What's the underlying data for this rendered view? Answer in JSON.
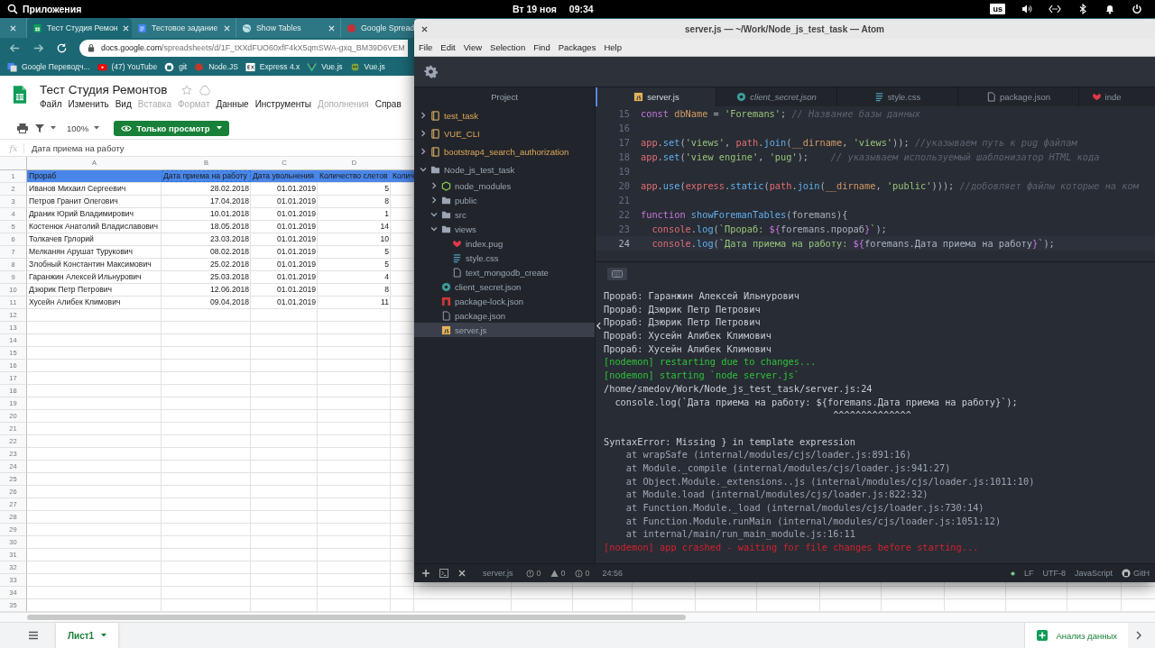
{
  "top_bar": {
    "apps_label": "Приложения",
    "date": "Вт 19 ноя",
    "time": "09:34",
    "keyboard_layout": "us"
  },
  "browser": {
    "tabs": [
      {
        "selected": false
      },
      {
        "label": "Тест Студия Ремон",
        "selected": true,
        "kind": "sheets"
      },
      {
        "label": "Тестовое задание",
        "selected": false,
        "kind": "docs"
      },
      {
        "label": "Show Tables",
        "selected": false,
        "kind": "globe"
      },
      {
        "label": "Google Spread",
        "selected": false,
        "kind": "red"
      }
    ],
    "address": {
      "host": "docs.google.com",
      "path": "/spreadsheets/d/1F_tXXdFUO60xfF4kX5qmSWA-gxq_BM39D6VEM"
    },
    "bookmarks": [
      {
        "label": "Google Переводч...",
        "kind": "translate"
      },
      {
        "label": "(47) YouTube",
        "kind": "youtube"
      },
      {
        "label": "git",
        "kind": "github"
      },
      {
        "label": "Node.JS",
        "kind": "node"
      },
      {
        "label": "Express 4.x",
        "kind": "express"
      },
      {
        "label": "Vue.js",
        "kind": "vue"
      },
      {
        "label": "Vue.js",
        "kind": "robot"
      }
    ]
  },
  "sheet": {
    "title": "Тест Студия Ремонтов",
    "menu": [
      {
        "label": "Файл",
        "disabled": false
      },
      {
        "label": "Изменить",
        "disabled": false
      },
      {
        "label": "Вид",
        "disabled": false
      },
      {
        "label": "Вставка",
        "disabled": true
      },
      {
        "label": "Формат",
        "disabled": true
      },
      {
        "label": "Данные",
        "disabled": false
      },
      {
        "label": "Инструменты",
        "disabled": false
      },
      {
        "label": "Дополнения",
        "disabled": true
      },
      {
        "label": "Справ",
        "disabled": false
      }
    ],
    "zoom": "100%",
    "mode_button": "Только просмотр",
    "fx_label": "fx",
    "formula": "Дата приема на работу",
    "column_headers": [
      "A",
      "B",
      "C",
      "D"
    ],
    "rows": [
      {
        "number": "1",
        "kind": "header",
        "cells": [
          {
            "text": "Прораб",
            "copied": false
          },
          {
            "text": "Дата приема на работу",
            "copied": true
          },
          {
            "text": "Дата увольнения",
            "copied": false
          },
          {
            "text": "Количество слетов",
            "copied": false
          },
          {
            "text": "Колич",
            "copied": false
          }
        ]
      },
      {
        "number": "2",
        "kind": "data",
        "cells": [
          {
            "text": "Иванов Михаил Сергеевич"
          },
          {
            "text": "28.02.2018"
          },
          {
            "text": "01.01.2019"
          },
          {
            "text": "5"
          }
        ]
      },
      {
        "number": "3",
        "kind": "data",
        "cells": [
          {
            "text": "Петров Гранит Олегович"
          },
          {
            "text": "17.04.2018"
          },
          {
            "text": "01.01.2019"
          },
          {
            "text": "8"
          }
        ]
      },
      {
        "number": "4",
        "kind": "data",
        "cells": [
          {
            "text": "Драник Юрий Владимирович"
          },
          {
            "text": "10.01.2018"
          },
          {
            "text": "01.01.2019"
          },
          {
            "text": "1"
          }
        ]
      },
      {
        "number": "5",
        "kind": "data",
        "cells": [
          {
            "text": "Костенюк Анатолий Владиславович"
          },
          {
            "text": "18.05.2018"
          },
          {
            "text": "01.01.2019"
          },
          {
            "text": "14"
          }
        ]
      },
      {
        "number": "6",
        "kind": "data",
        "cells": [
          {
            "text": "Толкачев Грлорий"
          },
          {
            "text": "23.03.2018"
          },
          {
            "text": "01.01.2019"
          },
          {
            "text": "10"
          }
        ]
      },
      {
        "number": "7",
        "kind": "data",
        "cells": [
          {
            "text": "Мелканян Арушат Турукович"
          },
          {
            "text": "08.02.2018"
          },
          {
            "text": "01.01.2019"
          },
          {
            "text": "5"
          }
        ]
      },
      {
        "number": "8",
        "kind": "data",
        "cells": [
          {
            "text": "Злобный Константин Максимович"
          },
          {
            "text": "25.02.2018"
          },
          {
            "text": "01.01.2019"
          },
          {
            "text": "5"
          }
        ]
      },
      {
        "number": "9",
        "kind": "data",
        "cells": [
          {
            "text": "Гаранжин Алексей Ильнурович"
          },
          {
            "text": "25.03.2018"
          },
          {
            "text": "01.01.2019"
          },
          {
            "text": "4"
          }
        ]
      },
      {
        "number": "10",
        "kind": "data",
        "cells": [
          {
            "text": "Дзюрик Петр Петрович"
          },
          {
            "text": "12.06.2018"
          },
          {
            "text": "01.01.2019"
          },
          {
            "text": "8"
          }
        ]
      },
      {
        "number": "11",
        "kind": "data",
        "cells": [
          {
            "text": "Хусейн Алибек Климович"
          },
          {
            "text": "09.04.2018"
          },
          {
            "text": "01.01.2019"
          },
          {
            "text": "11"
          }
        ]
      },
      {
        "number": "12"
      },
      {
        "number": "13"
      },
      {
        "number": "14"
      },
      {
        "number": "15"
      },
      {
        "number": "16"
      },
      {
        "number": "17"
      },
      {
        "number": "18"
      },
      {
        "number": "19"
      },
      {
        "number": "20"
      },
      {
        "number": "21"
      },
      {
        "number": "22"
      },
      {
        "number": "23"
      },
      {
        "number": "24"
      },
      {
        "number": "25"
      },
      {
        "number": "26"
      },
      {
        "number": "27"
      },
      {
        "number": "28"
      },
      {
        "number": "29"
      },
      {
        "number": "30"
      },
      {
        "number": "31"
      },
      {
        "number": "32"
      },
      {
        "number": "33"
      },
      {
        "number": "34"
      },
      {
        "number": "35"
      }
    ],
    "sheet_tabs": [
      {
        "label": "Лист1",
        "selected": true
      }
    ],
    "explore_button": "Анализ данных"
  },
  "atom": {
    "title": "server.js — ~/Work/Node_js_test_task — Atom",
    "menu": [
      "File",
      "Edit",
      "View",
      "Selection",
      "Find",
      "Packages",
      "Help"
    ],
    "tree_title": "Project",
    "tree": [
      {
        "label": "test_task",
        "kind": "repo",
        "expanded": false,
        "selected": false
      },
      {
        "label": "VUE_CLI",
        "kind": "repo",
        "expanded": false,
        "selected": false
      },
      {
        "label": "bootstrap4_search_authorization",
        "kind": "repo",
        "expanded": false,
        "selected": false
      },
      {
        "label": "Node_js_test_task",
        "kind": "folder",
        "expanded": true,
        "selected": false,
        "children": [
          {
            "label": "node_modules",
            "kind": "node",
            "expanded": false,
            "selected": false
          },
          {
            "label": "public",
            "kind": "folder",
            "expanded": false,
            "selected": false
          },
          {
            "label": "src",
            "kind": "folder",
            "expanded": true,
            "selected": false
          },
          {
            "label": "views",
            "kind": "folder",
            "expanded": true,
            "selected": false,
            "children": [
              {
                "label": "index.pug",
                "kind": "pug",
                "selected": false
              },
              {
                "label": "style.css",
                "kind": "css",
                "selected": false
              },
              {
                "label": "text_mongodb_create",
                "kind": "file",
                "selected": false
              }
            ]
          },
          {
            "label": "client_secret.json",
            "kind": "secret",
            "selected": false
          },
          {
            "label": "package-lock.json",
            "kind": "npm",
            "selected": false
          },
          {
            "label": "package.json",
            "kind": "file",
            "selected": false
          },
          {
            "label": "server.js",
            "kind": "js",
            "selected": true
          }
        ]
      }
    ],
    "tabs": [
      {
        "label": "server.js",
        "kind": "js",
        "selected": true,
        "pending": false
      },
      {
        "label": "client_secret.json",
        "kind": "secret",
        "selected": false,
        "pending": true
      },
      {
        "label": "style.css",
        "kind": "css",
        "selected": false,
        "pending": false
      },
      {
        "label": "package.json",
        "kind": "file",
        "selected": false,
        "pending": false
      },
      {
        "label": "inde",
        "kind": "pug",
        "selected": false,
        "pending": false
      }
    ],
    "code": [
      {
        "number": "15",
        "current": false,
        "tokens": [
          {
            "kind": "kw",
            "text": "const "
          },
          {
            "kind": "var",
            "text": "dbName"
          },
          {
            "kind": "p",
            "text": " = "
          },
          {
            "kind": "str",
            "text": "'Foremans'"
          },
          {
            "kind": "p",
            "text": "; "
          },
          {
            "kind": "com",
            "text": "// Название базы данных"
          }
        ]
      },
      {
        "number": "16",
        "current": false
      },
      {
        "number": "17",
        "current": false,
        "tokens": [
          {
            "kind": "obj",
            "text": "app"
          },
          {
            "kind": "p",
            "text": "."
          },
          {
            "kind": "fn",
            "text": "set"
          },
          {
            "kind": "p",
            "text": "("
          },
          {
            "kind": "str",
            "text": "'views'"
          },
          {
            "kind": "p",
            "text": ", "
          },
          {
            "kind": "obj",
            "text": "path"
          },
          {
            "kind": "p",
            "text": "."
          },
          {
            "kind": "fn",
            "text": "join"
          },
          {
            "kind": "p",
            "text": "("
          },
          {
            "kind": "var",
            "text": "__dirname"
          },
          {
            "kind": "p",
            "text": ", "
          },
          {
            "kind": "str",
            "text": "'views'"
          },
          {
            "kind": "p",
            "text": ")); "
          },
          {
            "kind": "com",
            "text": "//указываем путь к pug файлам"
          }
        ]
      },
      {
        "number": "18",
        "current": false,
        "tokens": [
          {
            "kind": "obj",
            "text": "app"
          },
          {
            "kind": "p",
            "text": "."
          },
          {
            "kind": "fn",
            "text": "set"
          },
          {
            "kind": "p",
            "text": "("
          },
          {
            "kind": "str",
            "text": "'view engine'"
          },
          {
            "kind": "p",
            "text": ", "
          },
          {
            "kind": "str",
            "text": "'pug'"
          },
          {
            "kind": "p",
            "text": ");    "
          },
          {
            "kind": "com",
            "text": "// указываем используемый шаблонизатор HTML кода"
          }
        ]
      },
      {
        "number": "19",
        "current": false
      },
      {
        "number": "20",
        "current": false,
        "tokens": [
          {
            "kind": "obj",
            "text": "app"
          },
          {
            "kind": "p",
            "text": "."
          },
          {
            "kind": "fn",
            "text": "use"
          },
          {
            "kind": "p",
            "text": "("
          },
          {
            "kind": "obj",
            "text": "express"
          },
          {
            "kind": "p",
            "text": "."
          },
          {
            "kind": "fn",
            "text": "static"
          },
          {
            "kind": "p",
            "text": "("
          },
          {
            "kind": "obj",
            "text": "path"
          },
          {
            "kind": "p",
            "text": "."
          },
          {
            "kind": "fn",
            "text": "join"
          },
          {
            "kind": "p",
            "text": "("
          },
          {
            "kind": "var",
            "text": "__dirname"
          },
          {
            "kind": "p",
            "text": ", "
          },
          {
            "kind": "str",
            "text": "'public'"
          },
          {
            "kind": "p",
            "text": "))); "
          },
          {
            "kind": "com",
            "text": "//добовляет файлы которые на ком"
          }
        ]
      },
      {
        "number": "21",
        "current": false
      },
      {
        "number": "22",
        "current": false,
        "tokens": [
          {
            "kind": "kw",
            "text": "function "
          },
          {
            "kind": "fn",
            "text": "showForemanTables"
          },
          {
            "kind": "p",
            "text": "(foremans){"
          }
        ]
      },
      {
        "number": "23",
        "current": false,
        "tokens": [
          {
            "kind": "obj",
            "text": "  console"
          },
          {
            "kind": "p",
            "text": "."
          },
          {
            "kind": "fn",
            "text": "log"
          },
          {
            "kind": "p",
            "text": "("
          },
          {
            "kind": "str",
            "text": "`Прораб: "
          },
          {
            "kind": "tpl",
            "text": "${"
          },
          {
            "kind": "p",
            "text": "foremans.прораб"
          },
          {
            "kind": "tpl",
            "text": "}"
          },
          {
            "kind": "str",
            "text": "`"
          },
          {
            "kind": "p",
            "text": ");"
          }
        ]
      },
      {
        "number": "24",
        "current": true,
        "tokens": [
          {
            "kind": "obj",
            "text": "  console"
          },
          {
            "kind": "p",
            "text": "."
          },
          {
            "kind": "fn",
            "text": "log"
          },
          {
            "kind": "p",
            "text": "("
          },
          {
            "kind": "str",
            "text": "`Дата приема на работу: "
          },
          {
            "kind": "tpl",
            "text": "${"
          },
          {
            "kind": "p",
            "text": "foremans.Дата приема на работу"
          },
          {
            "kind": "tpl",
            "text": "}"
          },
          {
            "kind": "str",
            "text": "`"
          },
          {
            "kind": "p",
            "text": ");"
          }
        ]
      }
    ],
    "terminal": [
      {
        "kind": "out",
        "text": "Прораб: Гаранжин Алексей Ильнурович"
      },
      {
        "kind": "out",
        "text": "Прораб: Дзюрик Петр Петрович"
      },
      {
        "kind": "out",
        "text": "Прораб: Дзюрик Петр Петрович"
      },
      {
        "kind": "out",
        "text": "Прораб: Хусейн Алибек Климович"
      },
      {
        "kind": "out",
        "text": "Прораб: Хусейн Алибек Климович"
      },
      {
        "kind": "info",
        "text": "[nodemon] restarting due to changes..."
      },
      {
        "kind": "info",
        "text": "[nodemon] starting `node server.js`"
      },
      {
        "kind": "out",
        "text": "/home/smedov/Work/Node_js_test_task/server.js:24"
      },
      {
        "kind": "out",
        "text": "  console.log(`Дата приема на работу: ${foremans.Дата приема на работу}`);"
      },
      {
        "kind": "out",
        "text": "                                         ^^^^^^^^^^^^^^"
      },
      {
        "kind": "blank"
      },
      {
        "kind": "out",
        "text": "SyntaxError: Missing } in template expression"
      },
      {
        "kind": "trace",
        "text": "    at wrapSafe (internal/modules/cjs/loader.js:891:16)"
      },
      {
        "kind": "trace",
        "text": "    at Module._compile (internal/modules/cjs/loader.js:941:27)"
      },
      {
        "kind": "trace",
        "text": "    at Object.Module._extensions..js (internal/modules/cjs/loader.js:1011:10)"
      },
      {
        "kind": "trace",
        "text": "    at Module.load (internal/modules/cjs/loader.js:822:32)"
      },
      {
        "kind": "trace",
        "text": "    at Function.Module._load (internal/modules/cjs/loader.js:730:14)"
      },
      {
        "kind": "trace",
        "text": "    at Function.Module.runMain (internal/modules/cjs/loader.js:1051:12)"
      },
      {
        "kind": "trace",
        "text": "    at internal/main/run_main_module.js:16:11"
      },
      {
        "kind": "error",
        "text": "[nodemon] app crashed - waiting for file changes before starting..."
      }
    ],
    "status": {
      "file": "server.js",
      "errors": "0",
      "warnings": "0",
      "infos": "0",
      "cursor": "24:56",
      "line_ending": "LF",
      "encoding": "UTF-8",
      "grammar": "JavaScript",
      "git": "GitH"
    }
  }
}
